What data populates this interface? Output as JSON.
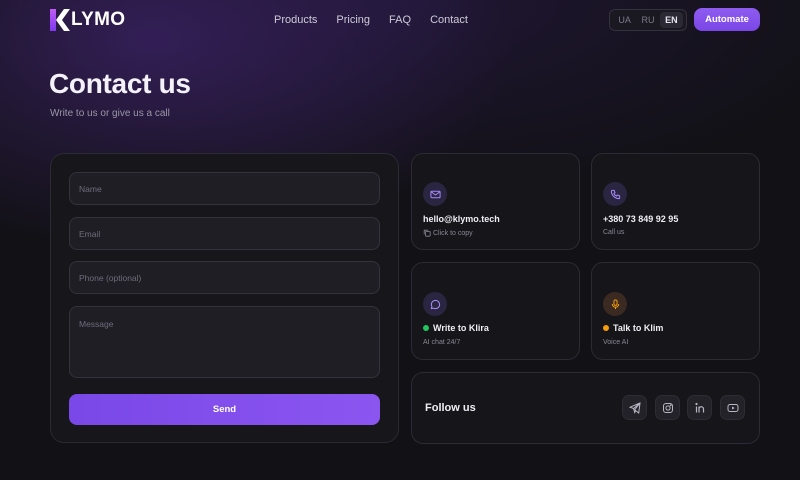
{
  "brand": {
    "logo_letter": "K",
    "name": "LYMO"
  },
  "nav": {
    "items": [
      "Products",
      "Pricing",
      "FAQ",
      "Contact"
    ]
  },
  "languages": {
    "options": [
      "UA",
      "RU",
      "EN"
    ],
    "selected": "EN"
  },
  "header": {
    "cta_label": "Automate"
  },
  "page": {
    "title": "Contact us",
    "subtitle": "Write to us or give us a call"
  },
  "form": {
    "name_placeholder": "Name",
    "email_placeholder": "Email",
    "phone_placeholder": "Phone (optional)",
    "message_placeholder": "Message",
    "submit_label": "Send"
  },
  "cards": {
    "email": {
      "title": "hello@klymo.tech",
      "subtitle": "Click to copy",
      "icon": "mail-icon"
    },
    "phone": {
      "title": "+380 73 849 92 95",
      "subtitle": "Call us",
      "icon": "phone-icon"
    },
    "chat": {
      "title": "Write to Klira",
      "subtitle": "AI chat 24/7",
      "icon": "chat-bubble-icon",
      "dot_color": "#22c55e"
    },
    "voice": {
      "title": "Talk to Klim",
      "subtitle": "Voice AI",
      "icon": "microphone-icon",
      "dot_color": "#f59e0b"
    }
  },
  "social": {
    "label": "Follow us",
    "icons": [
      "telegram-icon",
      "instagram-icon",
      "linkedin-icon",
      "youtube-icon"
    ]
  },
  "colors": {
    "accent": "#8b55f0",
    "background": "#121116",
    "card": "#16151a"
  }
}
